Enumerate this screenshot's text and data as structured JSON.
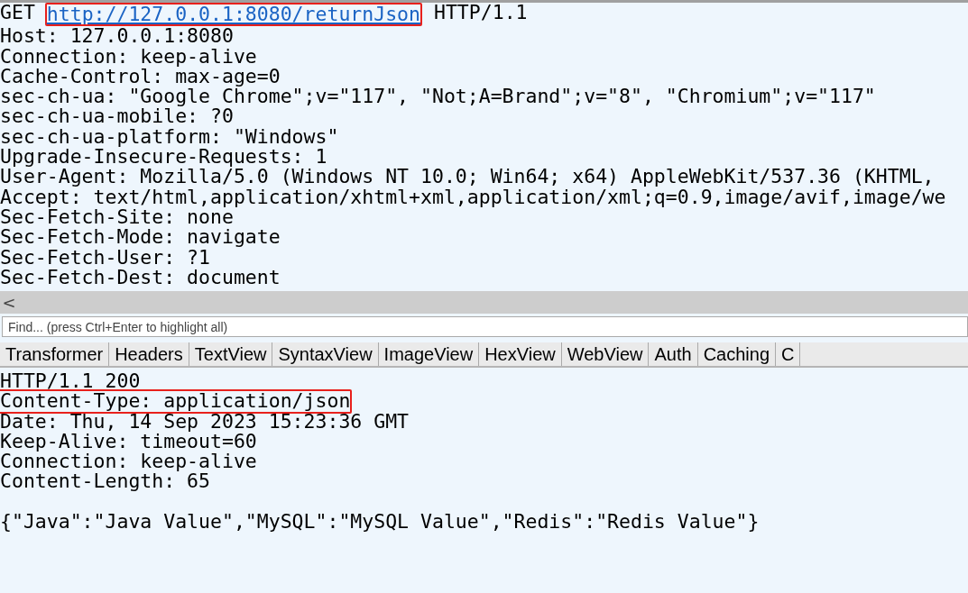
{
  "request": {
    "method": "GET",
    "url": "http://127.0.0.1:8080/returnJson",
    "version": "HTTP/1.1",
    "url_highlighted": true,
    "headers": [
      "Host: 127.0.0.1:8080",
      "Connection: keep-alive",
      "Cache-Control: max-age=0",
      "sec-ch-ua: \"Google Chrome\";v=\"117\", \"Not;A=Brand\";v=\"8\", \"Chromium\";v=\"117\"",
      "sec-ch-ua-mobile: ?0",
      "sec-ch-ua-platform: \"Windows\"",
      "Upgrade-Insecure-Requests: 1",
      "User-Agent: Mozilla/5.0 (Windows NT 10.0; Win64; x64) AppleWebKit/537.36 (KHTML,",
      "Accept: text/html,application/xhtml+xml,application/xml;q=0.9,image/avif,image/we",
      "Sec-Fetch-Site: none",
      "Sec-Fetch-Mode: navigate",
      "Sec-Fetch-User: ?1",
      "Sec-Fetch-Dest: document"
    ]
  },
  "scroll_left": "<",
  "find": {
    "placeholder": "Find... (press Ctrl+Enter to highlight all)"
  },
  "tabs": [
    "Transformer",
    "Headers",
    "TextView",
    "SyntaxView",
    "ImageView",
    "HexView",
    "WebView",
    "Auth",
    "Caching",
    "C"
  ],
  "response": {
    "lines": [
      {
        "text": "HTTP/1.1 200",
        "highlighted": false
      },
      {
        "text": "Content-Type: application/json",
        "highlighted": true
      },
      {
        "text": "Date: Thu, 14 Sep 2023 15:23:36 GMT",
        "highlighted": false
      },
      {
        "text": "Keep-Alive: timeout=60",
        "highlighted": false
      },
      {
        "text": "Connection: keep-alive",
        "highlighted": false
      },
      {
        "text": "Content-Length: 65",
        "highlighted": false
      }
    ],
    "body": "{\"Java\":\"Java Value\",\"MySQL\":\"MySQL Value\",\"Redis\":\"Redis Value\"}"
  }
}
